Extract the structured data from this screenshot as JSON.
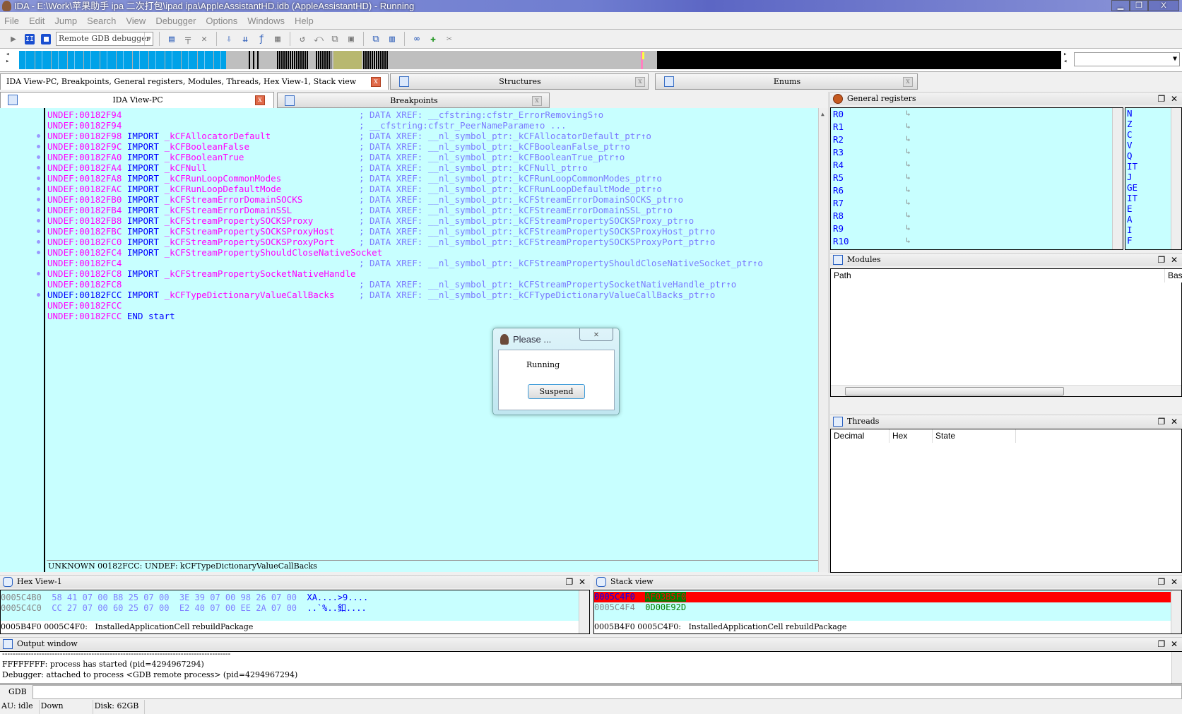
{
  "window": {
    "title": "IDA - E:\\Work\\苹果助手 ipa 二次打包\\ipad ipa\\AppleAssistantHD.idb (AppleAssistantHD) - Running"
  },
  "menu": [
    "File",
    "Edit",
    "Jump",
    "Search",
    "View",
    "Debugger",
    "Options",
    "Windows",
    "Help"
  ],
  "toolbar": {
    "debugger_select": "Remote GDB debugger"
  },
  "tabs": {
    "main": "IDA View-PC, Breakpoints, General registers, Modules, Threads, Hex View-1, Stack view",
    "structures": "Structures",
    "enums": "Enums",
    "ida_view": "IDA View-PC",
    "breakpoints": "Breakpoints"
  },
  "code_lines": [
    {
      "addr": "UNDEF:00182F94",
      "kw": "",
      "name": "",
      "comment": "; DATA XREF: __cfstring:cfstr_ErrorRemovingS↑o",
      "dot": false
    },
    {
      "addr": "UNDEF:00182F94",
      "kw": "",
      "name": "",
      "comment": "; __cfstring:cfstr_PeerNameParame↑o ...",
      "dot": false
    },
    {
      "addr": "UNDEF:00182F98",
      "kw": "IMPORT",
      "name": "_kCFAllocatorDefault",
      "comment": "; DATA XREF: __nl_symbol_ptr:_kCFAllocatorDefault_ptr↑o",
      "dot": true
    },
    {
      "addr": "UNDEF:00182F9C",
      "kw": "IMPORT",
      "name": "_kCFBooleanFalse",
      "comment": "; DATA XREF: __nl_symbol_ptr:_kCFBooleanFalse_ptr↑o",
      "dot": true
    },
    {
      "addr": "UNDEF:00182FA0",
      "kw": "IMPORT",
      "name": "_kCFBooleanTrue",
      "comment": "; DATA XREF: __nl_symbol_ptr:_kCFBooleanTrue_ptr↑o",
      "dot": true
    },
    {
      "addr": "UNDEF:00182FA4",
      "kw": "IMPORT",
      "name": "_kCFNull",
      "comment": "; DATA XREF: __nl_symbol_ptr:_kCFNull_ptr↑o",
      "dot": true
    },
    {
      "addr": "UNDEF:00182FA8",
      "kw": "IMPORT",
      "name": "_kCFRunLoopCommonModes",
      "comment": "; DATA XREF: __nl_symbol_ptr:_kCFRunLoopCommonModes_ptr↑o",
      "dot": true
    },
    {
      "addr": "UNDEF:00182FAC",
      "kw": "IMPORT",
      "name": "_kCFRunLoopDefaultMode",
      "comment": "; DATA XREF: __nl_symbol_ptr:_kCFRunLoopDefaultMode_ptr↑o",
      "dot": true
    },
    {
      "addr": "UNDEF:00182FB0",
      "kw": "IMPORT",
      "name": "_kCFStreamErrorDomainSOCKS",
      "comment": "; DATA XREF: __nl_symbol_ptr:_kCFStreamErrorDomainSOCKS_ptr↑o",
      "dot": true
    },
    {
      "addr": "UNDEF:00182FB4",
      "kw": "IMPORT",
      "name": "_kCFStreamErrorDomainSSL",
      "comment": "; DATA XREF: __nl_symbol_ptr:_kCFStreamErrorDomainSSL_ptr↑o",
      "dot": true
    },
    {
      "addr": "UNDEF:00182FB8",
      "kw": "IMPORT",
      "name": "_kCFStreamPropertySOCKSProxy",
      "comment": "; DATA XREF: __nl_symbol_ptr:_kCFStreamPropertySOCKSProxy_ptr↑o",
      "dot": true
    },
    {
      "addr": "UNDEF:00182FBC",
      "kw": "IMPORT",
      "name": "_kCFStreamPropertySOCKSProxyHost",
      "comment": "; DATA XREF: __nl_symbol_ptr:_kCFStreamPropertySOCKSProxyHost_ptr↑o",
      "dot": true
    },
    {
      "addr": "UNDEF:00182FC0",
      "kw": "IMPORT",
      "name": "_kCFStreamPropertySOCKSProxyPort",
      "comment": "; DATA XREF: __nl_symbol_ptr:_kCFStreamPropertySOCKSProxyPort_ptr↑o",
      "dot": true
    },
    {
      "addr": "UNDEF:00182FC4",
      "kw": "IMPORT",
      "name": "_kCFStreamPropertyShouldCloseNativeSocket",
      "comment": "",
      "dot": true
    },
    {
      "addr": "UNDEF:00182FC4",
      "kw": "",
      "name": "",
      "comment": "; DATA XREF: __nl_symbol_ptr:_kCFStreamPropertyShouldCloseNativeSocket_ptr↑o",
      "dot": false
    },
    {
      "addr": "UNDEF:00182FC8",
      "kw": "IMPORT",
      "name": "_kCFStreamPropertySocketNativeHandle",
      "comment": "",
      "dot": true
    },
    {
      "addr": "UNDEF:00182FC8",
      "kw": "",
      "name": "",
      "comment": "; DATA XREF: __nl_symbol_ptr:_kCFStreamPropertySocketNativeHandle_ptr↑o",
      "dot": false
    },
    {
      "addr": "UNDEF:00182FCC",
      "kw": "IMPORT",
      "name": "_kCFTypeDictionaryValueCallBacks",
      "comment": "; DATA XREF: __nl_symbol_ptr:_kCFTypeDictionaryValueCallBacks_ptr↑o",
      "dot": true,
      "current": true
    },
    {
      "addr": "UNDEF:00182FCC",
      "kw": "",
      "name": "",
      "comment": "",
      "dot": false
    },
    {
      "addr": "UNDEF:00182FCC",
      "kw": "END",
      "name": "start",
      "comment": "",
      "dot": false,
      "end": true
    }
  ],
  "code_status": "UNKNOWN 00182FCC: UNDEF: kCFTypeDictionaryValueCallBacks",
  "registers": {
    "title": "General registers",
    "names": [
      "R0",
      "R1",
      "R2",
      "R3",
      "R4",
      "R5",
      "R6",
      "R7",
      "R8",
      "R9",
      "R10"
    ],
    "flags": [
      "N",
      "Z",
      "C",
      "V",
      "Q",
      "IT",
      "J",
      "GE",
      "IT",
      "E",
      "A",
      "I",
      "F"
    ]
  },
  "modules": {
    "title": "Modules",
    "columns": [
      "Path",
      "Base"
    ]
  },
  "threads": {
    "title": "Threads",
    "columns": [
      "Decimal",
      "Hex",
      "State"
    ]
  },
  "hexview": {
    "title": "Hex View-1",
    "rows": [
      {
        "addr": "0005C4B0",
        "bytes": "58 41 07 00 B8 25 07 00  3E 39 07 00 98 26 07 00",
        "ascii": "XA....>9...."
      },
      {
        "addr": "0005C4C0",
        "bytes": "CC 27 07 00 60 25 07 00  E2 40 07 00 EE 2A 07 00",
        "ascii": "..`%..釦...."
      }
    ],
    "status": "0005B4F0 0005C4F0:   InstalledApplicationCell rebuildPackage"
  },
  "stackview": {
    "title": "Stack view",
    "rows": [
      {
        "addr": "0005C4F0",
        "value": "AF03B5F0",
        "highlight": true
      },
      {
        "addr": "0005C4F4",
        "value": "0D00E92D",
        "highlight": false
      }
    ],
    "status": "0005B4F0 0005C4F0:   InstalledApplicationCell rebuildPackage"
  },
  "output": {
    "title": "Output window",
    "separator": "---------------------------------------------------------------------------------------",
    "lines": [
      "FFFFFFFF: process  has started (pid=4294967294)",
      "Debugger: attached to process <GDB remote process> (pid=4294967294)"
    ],
    "cmd_label": "GDB"
  },
  "statusbar": {
    "au": "AU:  idle",
    "direction": "Down",
    "disk": "Disk: 62GB"
  },
  "dialog": {
    "title": "Please ...",
    "message": "Running",
    "button": "Suspend"
  },
  "colors": {
    "code_bg": "#c8ffff",
    "address": "#ff00ff",
    "keyword": "#0000ff",
    "comment": "#7b7bff",
    "stack_highlight": "#ff0000"
  }
}
